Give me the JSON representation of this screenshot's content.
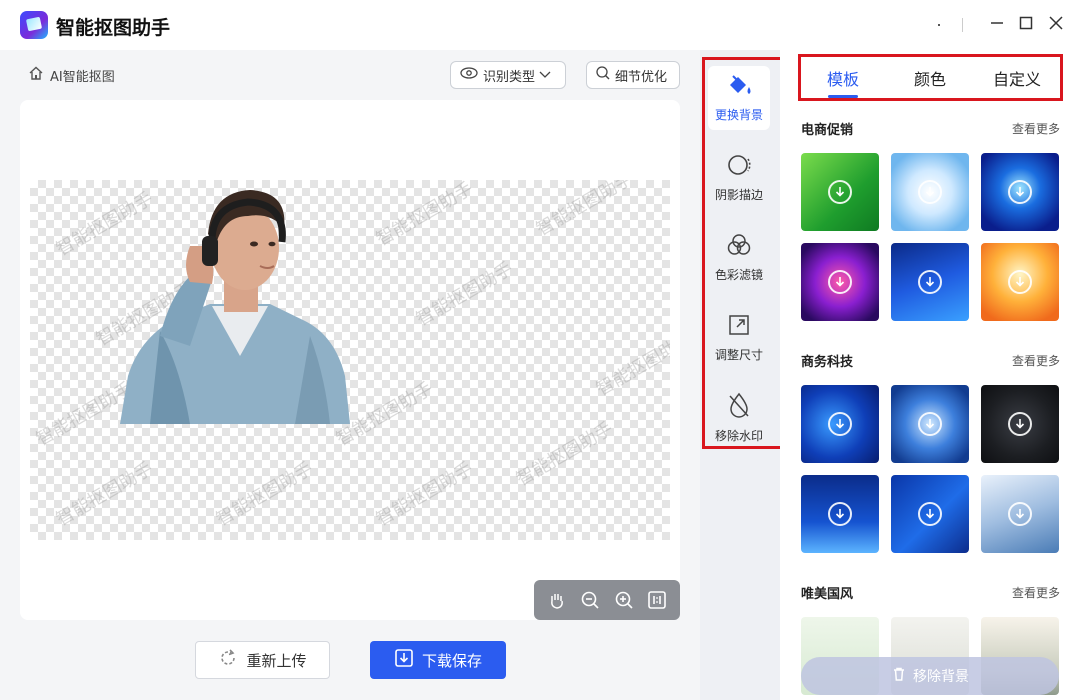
{
  "app": {
    "title": "智能抠图助手"
  },
  "toolbar": {
    "breadcrumb": "AI智能抠图",
    "recognize_type": "识别类型",
    "detail_optimize": "细节优化"
  },
  "canvas": {
    "watermark": "智能抠图助手"
  },
  "actions": {
    "reupload": "重新上传",
    "download": "下载保存"
  },
  "rail": {
    "items": [
      {
        "label": "更换背景",
        "icon": "paint-bucket-icon",
        "active": true
      },
      {
        "label": "阴影描边",
        "icon": "shadow-circle-icon"
      },
      {
        "label": "色彩滤镜",
        "icon": "color-filter-icon"
      },
      {
        "label": "调整尺寸",
        "icon": "resize-icon"
      },
      {
        "label": "移除水印",
        "icon": "remove-watermark-icon"
      }
    ]
  },
  "panel": {
    "tabs": [
      {
        "label": "模板",
        "active": true
      },
      {
        "label": "颜色"
      },
      {
        "label": "自定义"
      }
    ],
    "sections": [
      {
        "title": "电商促销",
        "more": "查看更多"
      },
      {
        "title": "商务科技",
        "more": "查看更多"
      },
      {
        "title": "唯美国风",
        "more": "查看更多"
      }
    ],
    "remove_bg": "移除背景"
  },
  "colors": {
    "accent": "#2b5cf0",
    "highlight": "#d9161e"
  }
}
